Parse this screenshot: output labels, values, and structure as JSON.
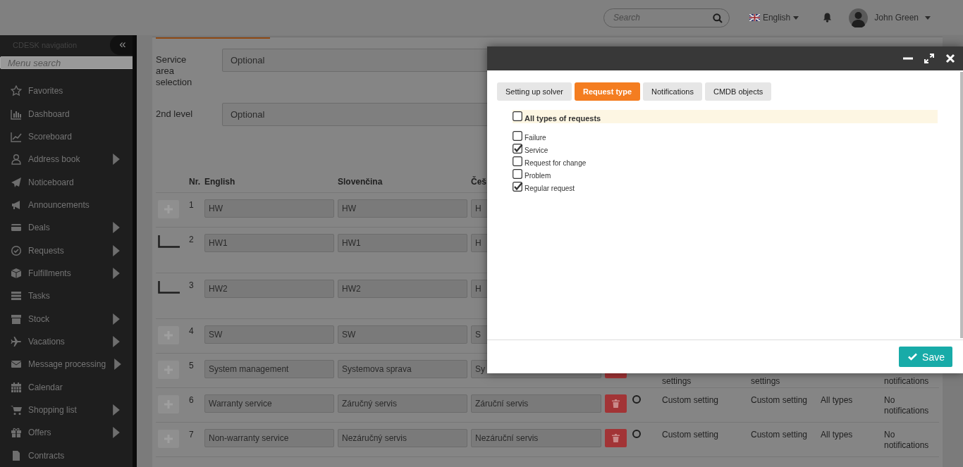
{
  "header": {
    "search": {
      "placeholder": "Search"
    },
    "language": "English",
    "user": "John Green"
  },
  "sidebar": {
    "title": "CDESK navigation",
    "collapse": "«",
    "search": {
      "placeholder": "Menu search"
    },
    "items": [
      {
        "label": "Favorites",
        "has_submenu": false
      },
      {
        "label": "Dashboard",
        "has_submenu": false
      },
      {
        "label": "Scoreboard",
        "has_submenu": false
      },
      {
        "label": "Address book",
        "has_submenu": true
      },
      {
        "label": "Noticeboard",
        "has_submenu": false
      },
      {
        "label": "Announcements",
        "has_submenu": false
      },
      {
        "label": "Deals",
        "has_submenu": true
      },
      {
        "label": "Requests",
        "has_submenu": true
      },
      {
        "label": "Fulfillments",
        "has_submenu": true
      },
      {
        "label": "Tasks",
        "has_submenu": false
      },
      {
        "label": "Stock",
        "has_submenu": true
      },
      {
        "label": "Vacations",
        "has_submenu": true
      },
      {
        "label": "Message processing",
        "has_submenu": true
      },
      {
        "label": "Calendar",
        "has_submenu": false
      },
      {
        "label": "Shopping list",
        "has_submenu": true
      },
      {
        "label": "Offers",
        "has_submenu": true
      },
      {
        "label": "Contracts",
        "has_submenu": false
      }
    ]
  },
  "form": {
    "fields": [
      {
        "label": "Service area selection",
        "value": "Optional"
      },
      {
        "label": "2nd level",
        "value": "Optional"
      }
    ]
  },
  "table": {
    "columns": [
      "Nr.",
      "English",
      "Slovenčina",
      "Češ"
    ],
    "rows": [
      {
        "kind": "root",
        "nr": "1",
        "values": [
          "HW",
          "HW",
          "H"
        ]
      },
      {
        "kind": "child",
        "nr": "2",
        "values": [
          "HW1",
          "HW1",
          "H"
        ]
      },
      {
        "kind": "child",
        "nr": "3",
        "values": [
          "HW2",
          "HW2",
          "H"
        ]
      },
      {
        "kind": "root",
        "nr": "4",
        "values": [
          "SW",
          "SW",
          "S"
        ]
      },
      {
        "kind": "root",
        "nr": "5",
        "values": [
          "System management",
          "Systemova sprava",
          "Sy"
        ],
        "extras_cut": true,
        "extras": {
          "column_5": "settings",
          "column_6": "settings",
          "column_8": "notifications"
        }
      },
      {
        "kind": "root",
        "nr": "6",
        "values": [
          "Warranty service",
          "Záručný servis",
          "Záruční servis"
        ],
        "selected": false,
        "extras_cut": false,
        "extras": {
          "column_5": "Custom setting",
          "column_6": "Custom setting",
          "column_7": "All types",
          "column_8": "No notifications"
        }
      },
      {
        "kind": "root",
        "nr": "7",
        "values": [
          "Non-warranty service",
          "Nezáručný servis",
          "Nezáruční servis"
        ],
        "selected": false,
        "extras_cut": false,
        "extras": {
          "column_5": "Custom setting",
          "column_6": "Custom setting",
          "column_7": "All types",
          "column_8": "No notifications"
        }
      }
    ]
  },
  "dialog": {
    "tabs": [
      {
        "label": "Setting up solver",
        "selected": false
      },
      {
        "label": "Request type",
        "selected": true
      },
      {
        "label": "Notifications",
        "selected": false
      },
      {
        "label": "CMDB objects",
        "selected": false
      }
    ],
    "all_option": {
      "label": "All types of requests",
      "checked": false
    },
    "options": [
      {
        "label": "Failure",
        "checked": false
      },
      {
        "label": "Service",
        "checked": true
      },
      {
        "label": "Request for change",
        "checked": false
      },
      {
        "label": "Problem",
        "checked": false
      },
      {
        "label": "Regular request",
        "checked": true
      }
    ],
    "save": "Save"
  }
}
